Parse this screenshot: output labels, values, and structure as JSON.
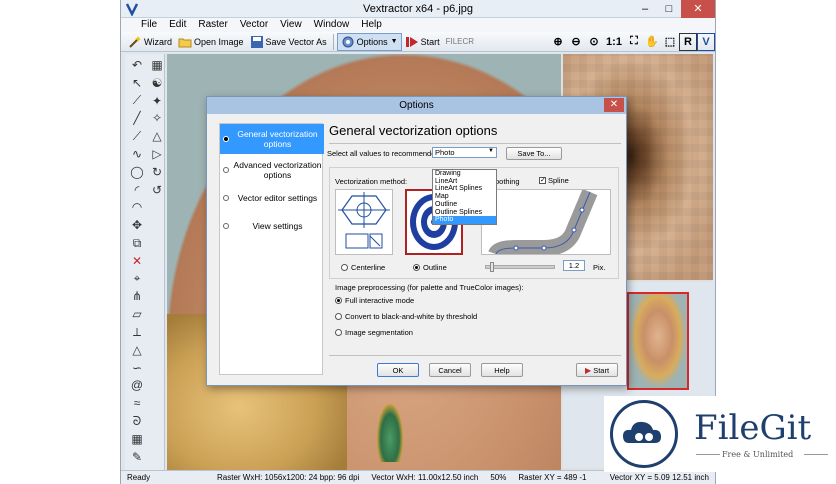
{
  "window": {
    "title": "Vextractor x64 - p6.jpg",
    "minimize": "–",
    "maximize": "□",
    "close": "✕"
  },
  "menu": [
    "File",
    "Edit",
    "Raster",
    "Vector",
    "View",
    "Window",
    "Help"
  ],
  "toolbar": {
    "wizard": "Wizard",
    "open_image": "Open Image",
    "save_vector_as": "Save Vector As",
    "options": "Options",
    "start": "Start",
    "watermark": "FILECR",
    "zoom_ratio": "1:1"
  },
  "dialog": {
    "title": "Options",
    "close": "✕",
    "nav": [
      "General vectorization options",
      "Advanced vectorization options",
      "Vector editor settings",
      "View settings"
    ],
    "heading": "General vectorization options",
    "recommend_label": "Select all values to recommended for:",
    "recommend_value": "Photo",
    "dropdown_options": [
      "Drawing",
      "LineArt",
      "LineArt Splines",
      "Map",
      "Outline",
      "Outline Splines",
      "Photo"
    ],
    "save_to": "Save To...",
    "method_label": "Vectorization method:",
    "centerline": "Centerline",
    "outline": "Outline",
    "smoothing": "oothing",
    "spline": "Spline",
    "spline_value": "1.2",
    "spline_unit": "Pix.",
    "preproc_label": "Image preprocessing (for palette and TrueColor images):",
    "preproc_options": [
      "Full interactive mode",
      "Convert to black-and-white by threshold",
      "Image segmentation"
    ],
    "ok": "OK",
    "cancel": "Cancel",
    "help": "Help",
    "start": "Start"
  },
  "status": {
    "ready": "Ready",
    "raster_wxh": "Raster WxH: 1056x1200: 24 bpp: 96 dpi",
    "vector_wxh": "Vector WxH: 11.00x12.50 inch",
    "percent": "50%",
    "raster_xy": "Raster XY = 489  -1",
    "vector_xy": "Vector XY = 5.09 12.51 inch"
  },
  "logo": {
    "name": "FileGit",
    "tagline": "Free & Unlimited"
  },
  "colors": {
    "accent": "#3399ff",
    "close_red": "#c7514a",
    "logo_blue": "#1f3f6e"
  }
}
